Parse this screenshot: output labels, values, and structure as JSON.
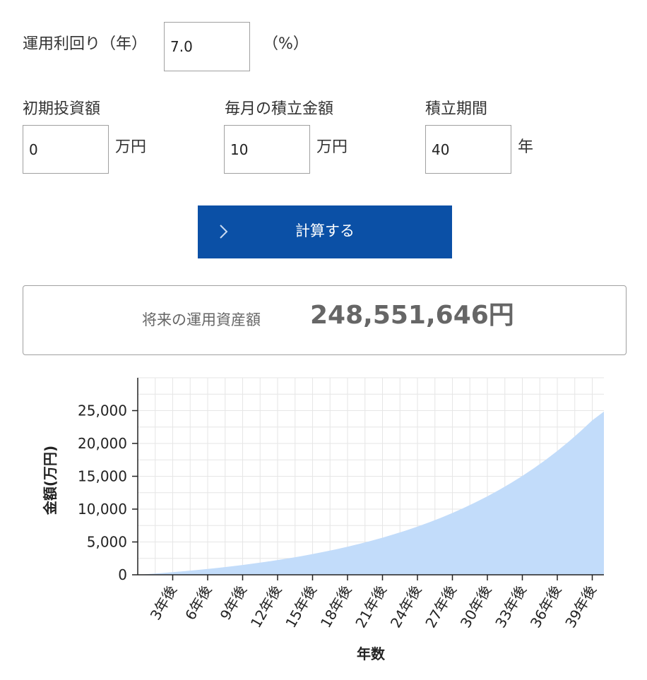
{
  "form": {
    "rate_label": "運用利回り（年）",
    "rate_value": "7.0",
    "rate_unit": "（%）",
    "initial_label": "初期投資額",
    "initial_value": "0",
    "initial_unit": "万円",
    "monthly_label": "毎月の積立金額",
    "monthly_value": "10",
    "monthly_unit": "万円",
    "period_label": "積立期間",
    "period_value": "40",
    "period_unit": "年",
    "calc_button": "計算する"
  },
  "result": {
    "label": "将来の運用資産額",
    "value": "248,551,646円"
  },
  "colors": {
    "button_bg": "#0b50a6",
    "area_fill": "#c2dcfa",
    "grid": "#e6e6e6"
  },
  "chart_data": {
    "type": "area",
    "xlabel": "年数",
    "ylabel": "金額(万円)",
    "ylim": [
      0,
      30000
    ],
    "yticks": [
      0,
      5000,
      10000,
      15000,
      20000,
      25000
    ],
    "ytick_labels": [
      "0",
      "5,000",
      "10,000",
      "15,000",
      "20,000",
      "25,000"
    ],
    "xlim": [
      0,
      40
    ],
    "xticks": [
      3,
      6,
      9,
      12,
      15,
      18,
      21,
      24,
      27,
      30,
      33,
      36,
      39
    ],
    "xtick_labels": [
      "3年後",
      "6年後",
      "9年後",
      "12年後",
      "15年後",
      "18年後",
      "21年後",
      "24年後",
      "27年後",
      "30年後",
      "33年後",
      "36年後",
      "39年後"
    ],
    "grid": true,
    "x": [
      0,
      1,
      2,
      3,
      4,
      5,
      6,
      7,
      8,
      9,
      10,
      11,
      12,
      13,
      14,
      15,
      16,
      17,
      18,
      19,
      20,
      21,
      22,
      23,
      24,
      25,
      26,
      27,
      28,
      29,
      30,
      31,
      32,
      33,
      34,
      35,
      36,
      37,
      38,
      39,
      40
    ],
    "values": [
      0,
      124,
      257,
      400,
      553,
      716,
      892,
      1080,
      1281,
      1497,
      1728,
      1976,
      2241,
      2525,
      2829,
      3154,
      3503,
      3876,
      4276,
      4704,
      5162,
      5652,
      6177,
      6738,
      7339,
      7983,
      8672,
      9409,
      10198,
      11042,
      11945,
      12912,
      13946,
      15053,
      16237,
      17504,
      18860,
      20311,
      21864,
      23525,
      24855
    ]
  }
}
